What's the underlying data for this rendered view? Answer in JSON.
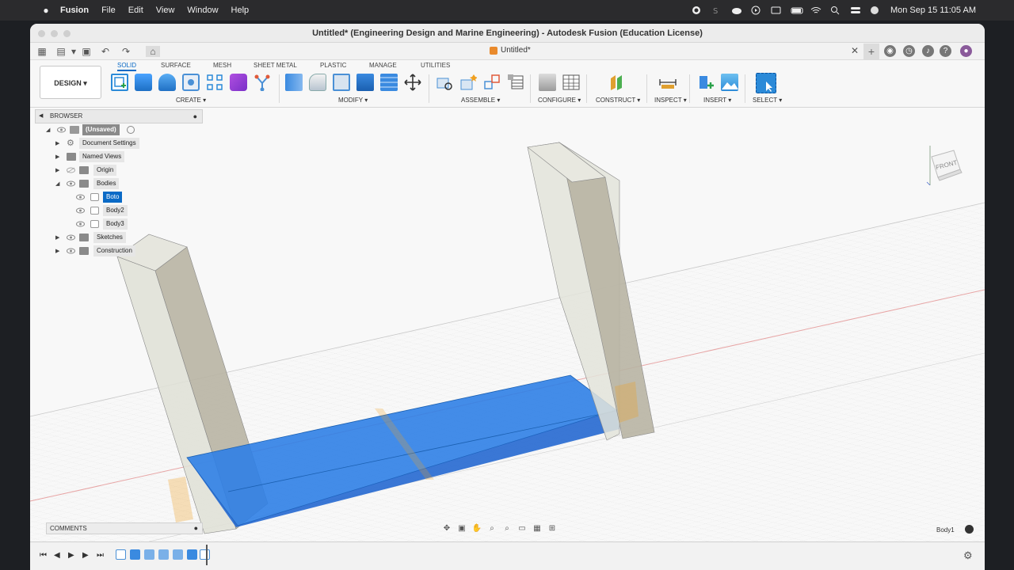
{
  "menubar": {
    "apple": "",
    "app": "Fusion",
    "items": [
      "File",
      "Edit",
      "View",
      "Window",
      "Help"
    ],
    "clock": "Mon Sep 15  11:05 AM"
  },
  "window": {
    "title": "Untitled* (Engineering Design and Marine Engineering) - Autodesk Fusion (Education License)"
  },
  "doc_tab": {
    "label": "Untitled*"
  },
  "toolbar": {
    "workspace": "DESIGN",
    "tabs": [
      "SOLID",
      "SURFACE",
      "MESH",
      "SHEET METAL",
      "PLASTIC",
      "MANAGE",
      "UTILITIES"
    ],
    "active_tab": "SOLID",
    "groups": [
      "CREATE",
      "MODIFY",
      "ASSEMBLE",
      "CONFIGURE",
      "CONSTRUCT",
      "INSPECT",
      "INSERT",
      "SELECT"
    ]
  },
  "browser": {
    "title": "BROWSER",
    "root": "(Unsaved)",
    "items": [
      "Document Settings",
      "Named Views",
      "Origin",
      "Bodies",
      "Sketches",
      "Construction"
    ],
    "bodies": [
      "Boto",
      "Body2",
      "Body3"
    ]
  },
  "comments": {
    "title": "COMMENTS"
  },
  "viewcube": {
    "face": "FRONT"
  },
  "status": {
    "selected_body": "Body1"
  },
  "colors": {
    "accent": "#0a6ac6",
    "body_blue": "#3f86e0",
    "body_glass": "#e5e6dc",
    "glass_side": "#b8b3a2"
  }
}
